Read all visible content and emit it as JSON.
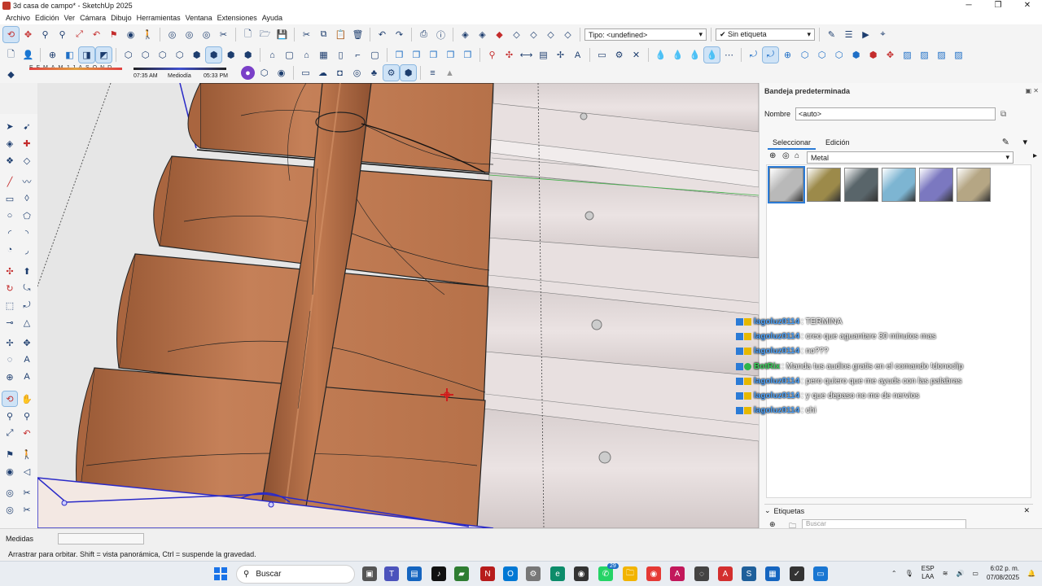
{
  "window": {
    "title": "3d casa de campo* - SketchUp 2025"
  },
  "menu": [
    "Archivo",
    "Edición",
    "Ver",
    "Cámara",
    "Dibujo",
    "Herramientas",
    "Ventana",
    "Extensiones",
    "Ayuda"
  ],
  "toolbar": {
    "tipo_combo": "Tipo: <undefined>",
    "etiqueta_combo": "Sin etiqueta",
    "months": [
      "E",
      "F",
      "M",
      "A",
      "M",
      "J",
      "J",
      "A",
      "S",
      "O",
      "N",
      "D"
    ],
    "time_start": "07:35 AM",
    "time_mid": "Mediodía",
    "time_end": "05:33 PM"
  },
  "tray": {
    "title": "Bandeja predeterminada",
    "name_label": "Nombre",
    "name_value": "<auto>",
    "tabs": [
      "Seleccionar",
      "Edición"
    ],
    "library": "Metal",
    "swatches": [
      {
        "name": "metal-silver",
        "color": "#b9b9b9"
      },
      {
        "name": "metal-gold",
        "color": "#9c8a4a"
      },
      {
        "name": "metal-dark-steel",
        "color": "#59656a"
      },
      {
        "name": "metal-blue-glass",
        "color": "#7db5d2"
      },
      {
        "name": "metal-purple",
        "color": "#7b78c0"
      },
      {
        "name": "metal-beige",
        "color": "#b5a684"
      }
    ],
    "etiquetas_label": "Etiquetas",
    "search_placeholder": "Buscar"
  },
  "chat": [
    {
      "user": "lagoluz0114",
      "text": ": TERMINA",
      "badge": "y"
    },
    {
      "user": "lagoluz0114",
      "text": ": creo que aguantare 30 minutos mas",
      "badge": "y"
    },
    {
      "user": "lagoluz0114",
      "text": ": no???",
      "badge": "y"
    },
    {
      "user": "BotRix",
      "text": ": Manda tus audios gratis en el comando !donoclip",
      "badge": "g"
    },
    {
      "user": "lagoluz0114",
      "text": ": pero quiero que me ayuds con las palabras",
      "badge": "y"
    },
    {
      "user": "lagoluz0114",
      "text": ": y que depaso no me de nervios",
      "badge": "y"
    },
    {
      "user": "lagoluz0114",
      "text": ": chi",
      "badge": "y"
    }
  ],
  "measures_label": "Medidas",
  "status_text": "Arrastrar para orbitar. Shift = vista panorámica, Ctrl = suspende la gravedad.",
  "taskbar": {
    "search": "Buscar",
    "lang": "ESP",
    "lang2": "LAA",
    "time": "6:02 p. m.",
    "date": "07/08/2025",
    "badge": "29"
  },
  "colors": {
    "terracotta": "#c07c55",
    "metal_roof": "#e3d8d8",
    "accent": "#2b7bd6"
  }
}
